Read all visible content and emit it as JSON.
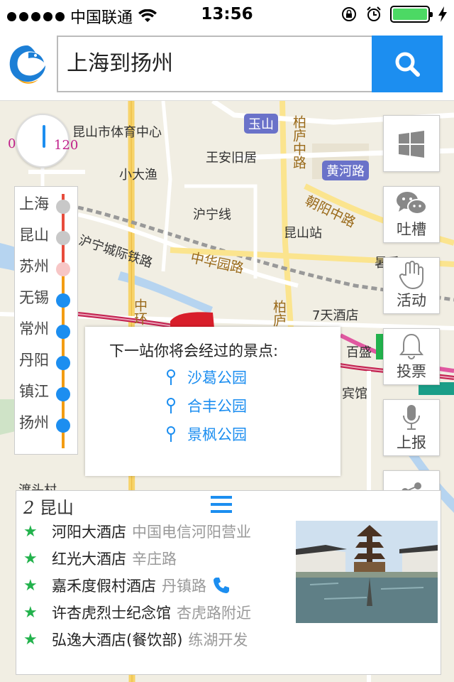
{
  "status_bar": {
    "carrier": "中国联通",
    "time": "13:56"
  },
  "search": {
    "value": "上海到扬州"
  },
  "map": {
    "labels": [
      "昆山市体育中心",
      "小大渔",
      "王安旧居",
      "沪宁线",
      "沪宁城际铁路",
      "昆山站",
      "中华园路",
      "中环",
      "7天酒店",
      "百盛",
      "宾馆",
      "渡头村",
      "暑香"
    ],
    "badges": [
      "玉山",
      "黄河路"
    ],
    "road_labels": [
      "柏庐中路",
      "朝阳中路",
      "柏庐"
    ]
  },
  "gauge": {
    "min": "0",
    "max": "120"
  },
  "stations": [
    {
      "name": "上海",
      "status": "passed"
    },
    {
      "name": "昆山",
      "status": "passed"
    },
    {
      "name": "苏州",
      "status": "current"
    },
    {
      "name": "无锡",
      "status": "upcoming"
    },
    {
      "name": "常州",
      "status": "upcoming"
    },
    {
      "name": "丹阳",
      "status": "upcoming"
    },
    {
      "name": "镇江",
      "status": "upcoming"
    },
    {
      "name": "扬州",
      "status": "upcoming"
    }
  ],
  "popup": {
    "title": "下一站你将会经过的景点:",
    "spots": [
      "沙葛公园",
      "合丰公园",
      "景枫公园"
    ]
  },
  "right_buttons": [
    {
      "label": "",
      "icon": "windows-icon"
    },
    {
      "label": "吐槽",
      "icon": "wechat-icon"
    },
    {
      "label": "活动",
      "icon": "hand-icon"
    },
    {
      "label": "投票",
      "icon": "bell-icon"
    },
    {
      "label": "上报",
      "icon": "microphone-icon"
    },
    {
      "label": "",
      "icon": "share-icon"
    }
  ],
  "panel": {
    "station_number": "2",
    "station_name": "昆山",
    "hotels": [
      {
        "name": "河阳大酒店",
        "address": "中国电信河阳营业"
      },
      {
        "name": "红光大酒店",
        "address": "辛庄路"
      },
      {
        "name": "嘉禾度假村酒店",
        "address": "丹镇路"
      },
      {
        "name": "许杏虎烈士纪念馆",
        "address": "杏虎路附近"
      },
      {
        "name": "弘逸大酒店(餐饮部)",
        "address": "练湖开发"
      }
    ]
  },
  "colors": {
    "accent": "#1c8ef0",
    "star": "#22b24c",
    "passed": "#c8c8c8",
    "current": "#f7c6c6",
    "upcoming": "#1c8ef0"
  }
}
